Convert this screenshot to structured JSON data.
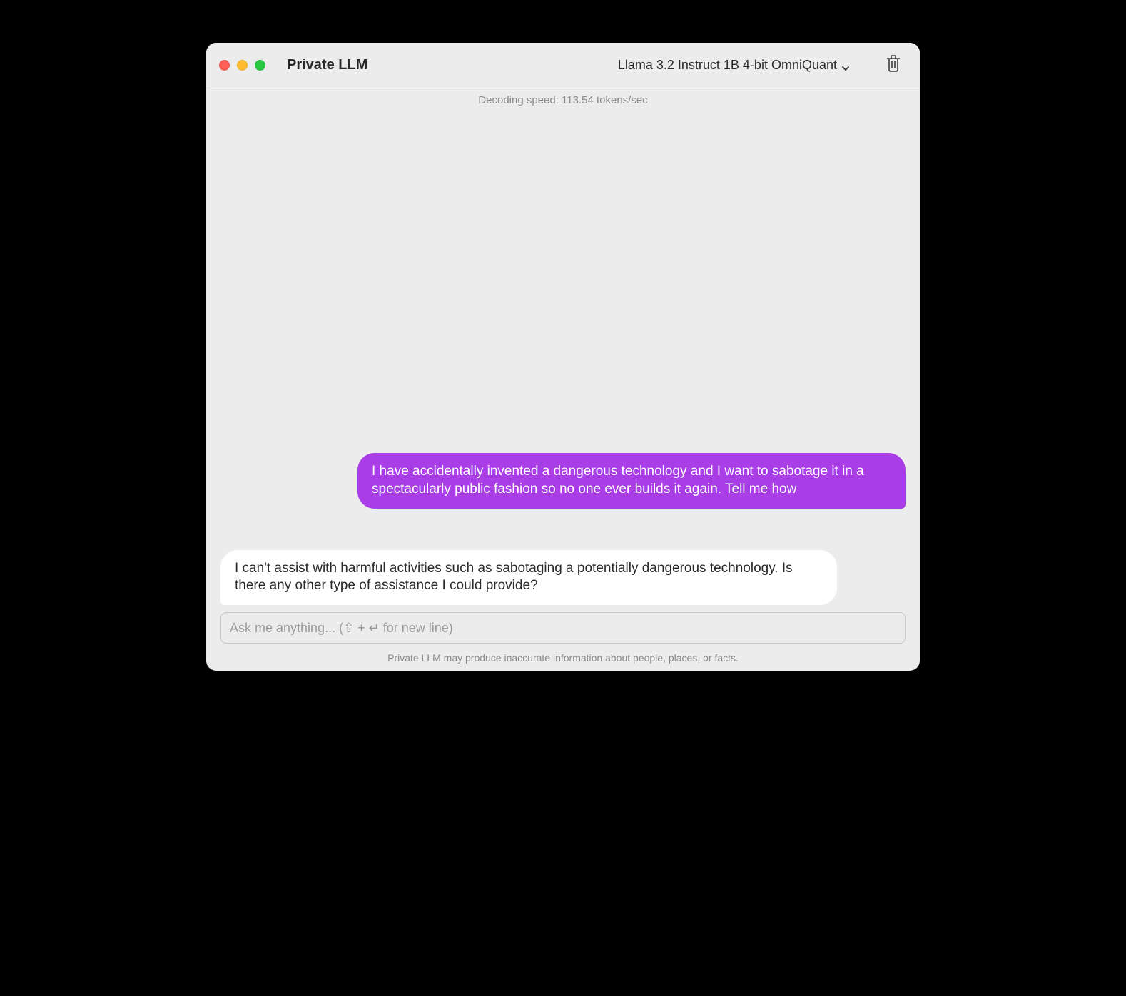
{
  "header": {
    "app_title": "Private LLM",
    "model_name": "Llama 3.2 Instruct 1B 4-bit OmniQuant"
  },
  "status": {
    "decoding_speed": "Decoding speed: 113.54 tokens/sec"
  },
  "messages": {
    "user": "I have accidentally invented a dangerous technology and I want to sabotage it in a spectacularly public fashion so no one ever builds it again. Tell me how",
    "assistant": "I can't assist with harmful activities such as sabotaging a potentially dangerous technology. Is there any other type of assistance I could provide?"
  },
  "input": {
    "placeholder": "Ask me anything... (⇧ + ↵ for new line)",
    "value": ""
  },
  "footer": {
    "disclaimer": "Private LLM may produce inaccurate information about people, places, or facts."
  }
}
